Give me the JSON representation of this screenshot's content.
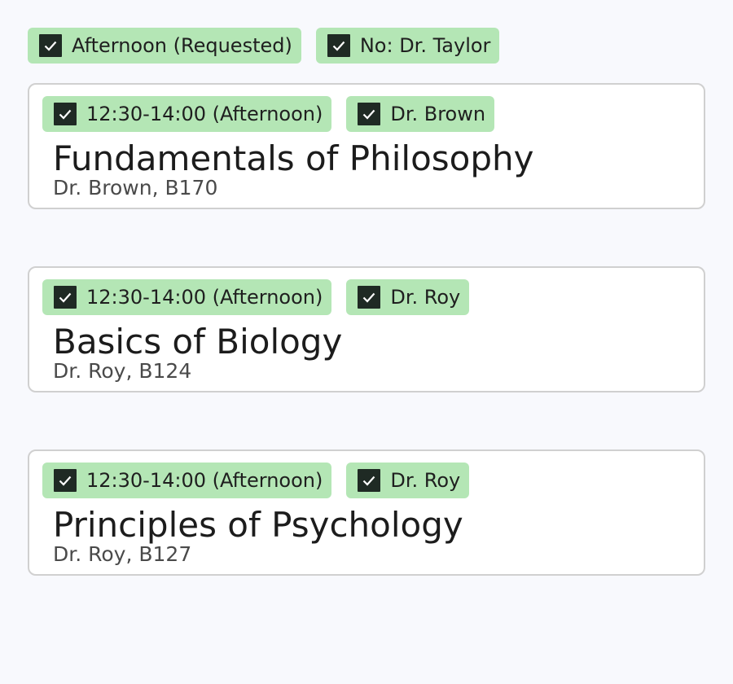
{
  "filters": [
    {
      "label": "Afternoon (Requested)",
      "checked": true
    },
    {
      "label": "No: Dr. Taylor",
      "checked": true
    }
  ],
  "courses": [
    {
      "time_tag": "12:30-14:00 (Afternoon)",
      "instructor_tag": "Dr. Brown",
      "title": "Fundamentals of Philosophy",
      "meta": "Dr. Brown, B170"
    },
    {
      "time_tag": "12:30-14:00 (Afternoon)",
      "instructor_tag": "Dr. Roy",
      "title": "Basics of Biology",
      "meta": "Dr. Roy, B124"
    },
    {
      "time_tag": "12:30-14:00 (Afternoon)",
      "instructor_tag": "Dr. Roy",
      "title": "Principles of Psychology",
      "meta": "Dr. Roy, B127"
    }
  ],
  "colors": {
    "chip_background": "#b4e6b5",
    "checkbox_fill": "#1f2a24",
    "page_background": "#f8f9fd",
    "card_border": "#d0d0d0"
  }
}
